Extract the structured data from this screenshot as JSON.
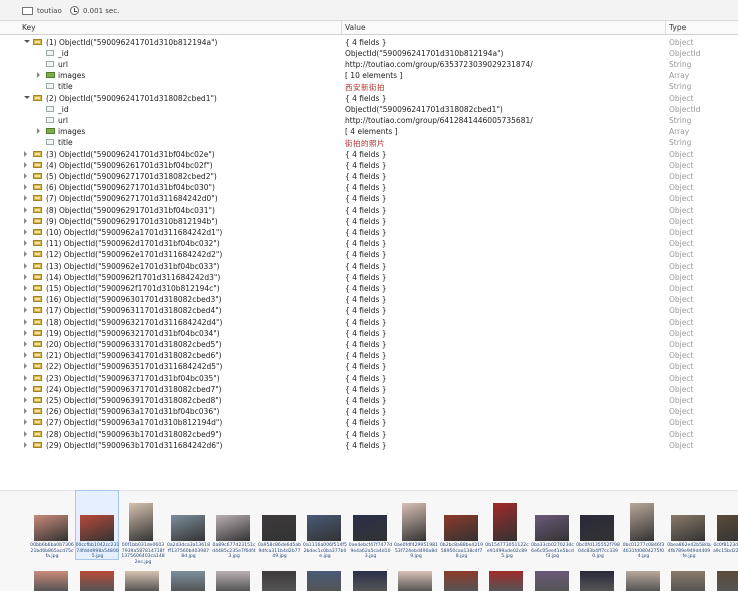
{
  "toolbar": {
    "collection": "toutiao",
    "time": "0.001 sec."
  },
  "columns": {
    "key": "Key",
    "value": "Value",
    "type": "Type"
  },
  "rows": [
    {
      "key": "(1) ObjectId(\"590096241701d310b812194a\")",
      "value": "{ 4 fields }",
      "type": "Object"
    },
    {
      "key": "_id",
      "value": "ObjectId(\"590096241701d310b812194a\")",
      "type": "ObjectId"
    },
    {
      "key": "url",
      "value": "http://toutiao.com/group/6353723039029231874/",
      "type": "String"
    },
    {
      "key": "images",
      "value": "[ 10 elements ]",
      "type": "Array"
    },
    {
      "key": "title",
      "value": "西安新街拍",
      "type": "String"
    },
    {
      "key": "(2) ObjectId(\"590096241701d318082cbed1\")",
      "value": "{ 4 fields }",
      "type": "Object"
    },
    {
      "key": "_id",
      "value": "ObjectId(\"590096241701d318082cbed1\")",
      "type": "ObjectId"
    },
    {
      "key": "url",
      "value": "http://toutiao.com/group/6412841446005735681/",
      "type": "String"
    },
    {
      "key": "images",
      "value": "[ 4 elements ]",
      "type": "Array"
    },
    {
      "key": "title",
      "value": "街拍的照片",
      "type": "String"
    },
    {
      "key": "(3) ObjectId(\"590096241701d31bf04bc02e\")",
      "value": "{ 4 fields }",
      "type": "Object"
    },
    {
      "key": "(4) ObjectId(\"590096261701d31bf04bc02f\")",
      "value": "{ 4 fields }",
      "type": "Object"
    },
    {
      "key": "(5) ObjectId(\"590096271701d318082cbed2\")",
      "value": "{ 4 fields }",
      "type": "Object"
    },
    {
      "key": "(6) ObjectId(\"590096271701d31bf04bc030\")",
      "value": "{ 4 fields }",
      "type": "Object"
    },
    {
      "key": "(7) ObjectId(\"590096271701d311684242d0\")",
      "value": "{ 4 fields }",
      "type": "Object"
    },
    {
      "key": "(8) ObjectId(\"590096291701d31bf04bc031\")",
      "value": "{ 4 fields }",
      "type": "Object"
    },
    {
      "key": "(9) ObjectId(\"590096291701d310b812194b\")",
      "value": "{ 4 fields }",
      "type": "Object"
    },
    {
      "key": "(10) ObjectId(\"5900962a1701d311684242d1\")",
      "value": "{ 4 fields }",
      "type": "Object"
    },
    {
      "key": "(11) ObjectId(\"5900962d1701d31bf04bc032\")",
      "value": "{ 4 fields }",
      "type": "Object"
    },
    {
      "key": "(12) ObjectId(\"5900962e1701d311684242d2\")",
      "value": "{ 4 fields }",
      "type": "Object"
    },
    {
      "key": "(13) ObjectId(\"5900962e1701d31bf04bc033\")",
      "value": "{ 4 fields }",
      "type": "Object"
    },
    {
      "key": "(14) ObjectId(\"5900962f1701d311684242d3\")",
      "value": "{ 4 fields }",
      "type": "Object"
    },
    {
      "key": "(15) ObjectId(\"5900962f1701d310b812194c\")",
      "value": "{ 4 fields }",
      "type": "Object"
    },
    {
      "key": "(16) ObjectId(\"590096301701d318082cbed3\")",
      "value": "{ 4 fields }",
      "type": "Object"
    },
    {
      "key": "(17) ObjectId(\"590096311701d318082cbed4\")",
      "value": "{ 4 fields }",
      "type": "Object"
    },
    {
      "key": "(18) ObjectId(\"590096321701d311684242d4\")",
      "value": "{ 4 fields }",
      "type": "Object"
    },
    {
      "key": "(19) ObjectId(\"590096321701d31bf04bc034\")",
      "value": "{ 4 fields }",
      "type": "Object"
    },
    {
      "key": "(20) ObjectId(\"590096331701d318082cbed5\")",
      "value": "{ 4 fields }",
      "type": "Object"
    },
    {
      "key": "(21) ObjectId(\"590096341701d318082cbed6\")",
      "value": "{ 4 fields }",
      "type": "Object"
    },
    {
      "key": "(22) ObjectId(\"590096351701d311684242d5\")",
      "value": "{ 4 fields }",
      "type": "Object"
    },
    {
      "key": "(23) ObjectId(\"590096371701d31bf04bc035\")",
      "value": "{ 4 fields }",
      "type": "Object"
    },
    {
      "key": "(24) ObjectId(\"590096371701d318082cbed7\")",
      "value": "{ 4 fields }",
      "type": "Object"
    },
    {
      "key": "(25) ObjectId(\"590096391701d318082cbed8\")",
      "value": "{ 4 fields }",
      "type": "Object"
    },
    {
      "key": "(26) ObjectId(\"5900963a1701d31bf04bc036\")",
      "value": "{ 4 fields }",
      "type": "Object"
    },
    {
      "key": "(27) ObjectId(\"5900963a1701d310b812194d\")",
      "value": "{ 4 fields }",
      "type": "Object"
    },
    {
      "key": "(28) ObjectId(\"5900963b1701d318082cbed9\")",
      "value": "{ 4 fields }",
      "type": "Object"
    },
    {
      "key": "(29) ObjectId(\"5900963b1701d311684242d6\")",
      "value": "{ 4 fields }",
      "type": "Object"
    }
  ],
  "thumbnails": [
    {
      "caption": "00bb6b6ba0b730621bd6b865acd75cfa.jpg",
      "color": "#c98a7a"
    },
    {
      "caption": "00ccfbb1042cc23174fddd998a548005.jpg",
      "color": "#b84a3a"
    },
    {
      "caption": "00f1bb031de06037939a587814718f1375606403ca1482ec.jpg",
      "color": "#d6c2b0"
    },
    {
      "caption": "0a2d3dca3a13618ff137560b4039878d.jpg",
      "color": "#7d8f9c"
    },
    {
      "caption": "0a89c677d23151cd4485c235e7f6df43.jpg",
      "color": "#b9b0b3"
    },
    {
      "caption": "0a958c86de6d5ab9dfca311b4d2b7749.jpg",
      "color": "#3e3a3d"
    },
    {
      "caption": "0a1116a006f514f52bdec1c0ba377b0e.jpg",
      "color": "#4a5a78"
    },
    {
      "caption": "0ae4ebcf47f7477d9e4a62a5ca4d103.jpg",
      "color": "#2a2f4a"
    },
    {
      "caption": "0ae0fdf42995198153f724ebd490a8d9.jpg",
      "color": "#d9c0b6"
    },
    {
      "caption": "0b2bc8a88be421958950caa138c4f78.jpg",
      "color": "#8c3a2a"
    },
    {
      "caption": "0b154773051122ce91499ade02c895.jpg",
      "color": "#a02a2a"
    },
    {
      "caption": "0ba33cb027023dc6e6c05ee41e5bcdf3.jpg",
      "color": "#6a5a7a"
    },
    {
      "caption": "0bc0fd135552f79804c83b4ff7cc3390.jpg",
      "color": "#2a2a3a"
    },
    {
      "caption": "0bc01277c0846f34631fd0804275f04.jpg",
      "color": "#b8a89a"
    },
    {
      "caption": "0bea862e42b58da4fb789e949d4409fe.jpg",
      "color": "#8a7a6a"
    },
    {
      "caption": "0c0f8123d14a231a9c15bd223b2.jpg",
      "color": "#5a4a3a"
    }
  ]
}
